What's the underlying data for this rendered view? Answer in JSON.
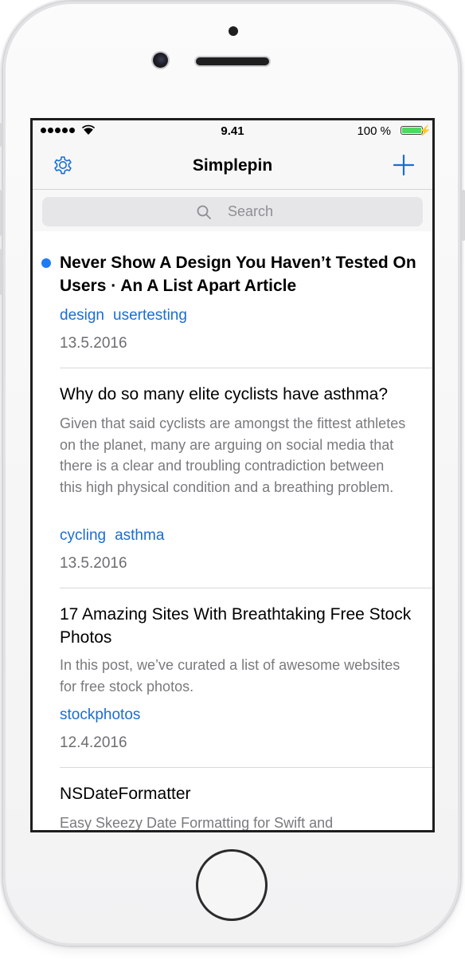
{
  "status_bar": {
    "time": "9.41",
    "battery_percent": "100 %",
    "battery_level": 1.0
  },
  "nav": {
    "title": "Simplepin",
    "settings_icon": "gear-icon",
    "add_icon": "plus-icon"
  },
  "search": {
    "placeholder": "Search",
    "icon": "magnifier-icon"
  },
  "bookmarks": [
    {
      "title": "Never Show A Design You Haven’t Tested On Users · An A List Apart Article",
      "unread": true,
      "description": "",
      "tags": [
        "design",
        "usertesting"
      ],
      "date": "13.5.2016"
    },
    {
      "title": "Why do so many elite cyclists have asthma?",
      "unread": false,
      "description": "Given that said cyclists are amongst the fittest athletes on the planet, many are arguing on social media that there is a clear and troubling contradiction between this high physical condition and a breathing problem.",
      "tags": [
        "cycling",
        "asthma"
      ],
      "date": "13.5.2016"
    },
    {
      "title": "17 Amazing Sites With Breathtaking Free Stock Photos",
      "unread": false,
      "description": "In this post, we’ve curated a list of awesome websites for free stock photos.",
      "tags": [
        "stockphotos"
      ],
      "date": "12.4.2016"
    },
    {
      "title": "NSDateFormatter",
      "unread": false,
      "description": "Easy Skeezy Date Formatting for Swift and",
      "tags": [],
      "date": ""
    }
  ],
  "colors": {
    "accent": "#1b6dd1",
    "unread_dot": "#1d7cf2",
    "battery": "#4cd964"
  }
}
